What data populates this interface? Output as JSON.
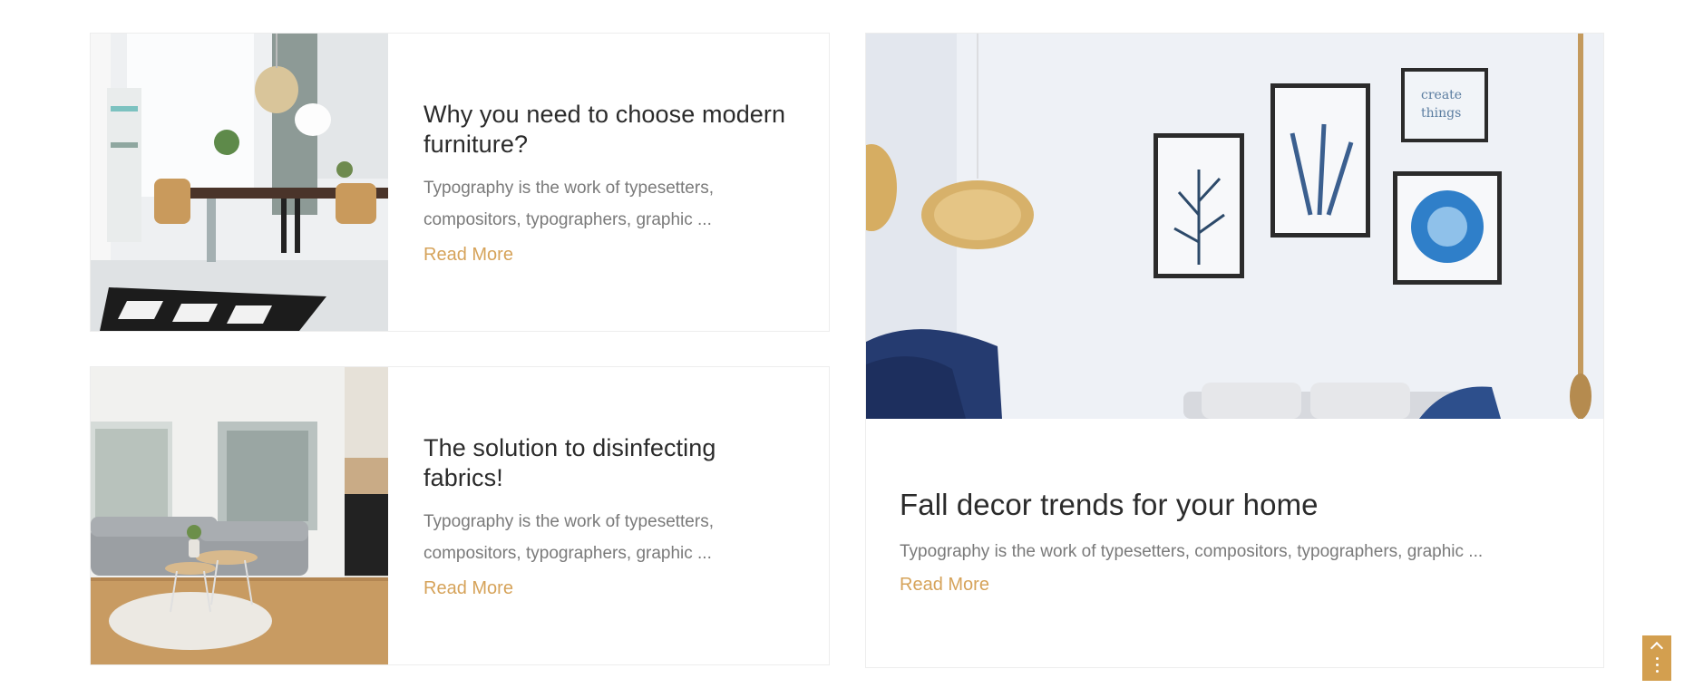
{
  "posts": [
    {
      "title": "Why you need to choose modern furniture?",
      "excerpt": "Typography is the work of typesetters, compositors, typographers, graphic ...",
      "read_more": "Read More"
    },
    {
      "title": "The solution to disinfecting fabrics!",
      "excerpt": "Typography is the work of typesetters, compositors, typographers, graphic ...",
      "read_more": "Read More"
    },
    {
      "title": "Fall decor trends for your home",
      "excerpt": "Typography is the work of typesetters, compositors, typographers, graphic ...",
      "read_more": "Read More"
    }
  ],
  "scroll_top": {
    "icon": "chevron-up-icon"
  },
  "colors": {
    "accent": "#d6a35a",
    "title": "#2b2b2b",
    "text": "#7a7a7a",
    "border": "#ededed"
  }
}
